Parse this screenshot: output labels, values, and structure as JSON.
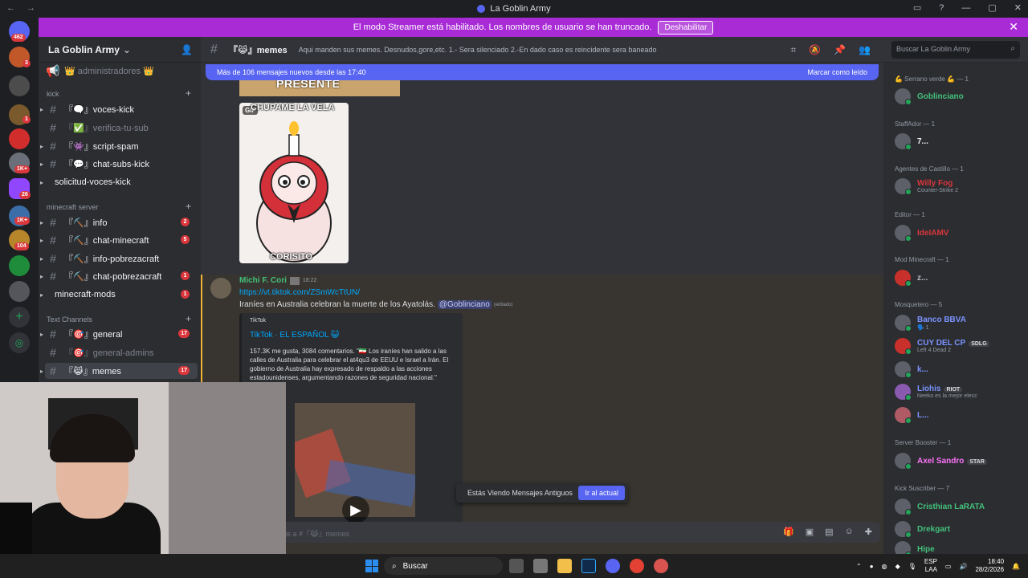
{
  "titlebar": {
    "title": "La Goblin Army"
  },
  "banner": {
    "text": "El modo Streamer está habilitado. Los nombres de usuario se han truncado.",
    "button": "Deshabilitar"
  },
  "guild": {
    "name": "La Goblin Army"
  },
  "channels": {
    "top_item": "👑 administradores 👑",
    "categories": {
      "kick": "kick",
      "minecraft": "minecraft server",
      "text": "Text Channels"
    },
    "kick_items": [
      {
        "label": "『🗨️』voces-kick",
        "count": ""
      },
      {
        "label": "『✅』verifica-tu-sub",
        "count": ""
      },
      {
        "label": "『👾』script-spam",
        "count": ""
      },
      {
        "label": "『💬』chat-subs-kick",
        "count": ""
      },
      {
        "label": "solicitud-voces-kick",
        "count": ""
      }
    ],
    "minecraft_items": [
      {
        "label": "『⛏️』info",
        "count": "2"
      },
      {
        "label": "『⛏️』chat-minecraft",
        "count": "5"
      },
      {
        "label": "『⛏️』info-pobrezacraft",
        "count": ""
      },
      {
        "label": "『⛏️』chat-pobrezacraft",
        "count": "1"
      },
      {
        "label": "minecraft-mods",
        "count": "1"
      }
    ],
    "text_items": [
      {
        "label": "『🎯』general",
        "count": "17"
      },
      {
        "label": "『🎯』general-admins",
        "count": ""
      },
      {
        "label": "『😹』memes",
        "count": "17"
      }
    ]
  },
  "header": {
    "channel": "『😹』memes",
    "topic": "Aqui manden sus memes. Desnudos,gore,etc. 1.- Sera silenciado 2.-En dado caso es reincidente sera baneado",
    "search_placeholder": "Buscar La Goblin Army"
  },
  "newbar": {
    "text": "Más de 106 mensajes nuevos desde las 17:40",
    "action": "Marcar como leído"
  },
  "images": {
    "top_caption": "PRESENTE",
    "gif_tag": "GIF",
    "gif_top": "CHUPAME LA VELA",
    "gif_bottom": "CORISITO"
  },
  "message": {
    "author": "Michi F. Cori",
    "time": "18:22",
    "link": "https://vt.tiktok.com/ZSmWcTtUN/",
    "text": "Iraníes en Australia celebran la muerte de los Ayatolás.",
    "mention": "@Goblinciano",
    "edited": "(editado)",
    "embed": {
      "provider": "TikTok",
      "title": "TikTok · EL ESPAÑOL 😺",
      "description": "157.3K me gusta, 3084 comentarios. \"🇮🇷 Los iraníes han salido a las calles de Australia para celebrar el at4qu3 de EEUU e Israel a Irán. El gobierno de Australia hay expresado de respaldo a las acciones estadounidenses, argumentando razones de seguridad nacional.\""
    }
  },
  "oldbar": {
    "text": "Estás Viendo Mensajes Antiguos",
    "button": "Ir al actual"
  },
  "composer": {
    "placeholder": "aje a #『😹』memes"
  },
  "members": {
    "roles": [
      {
        "label": "💪 Serrano verde 💪 — 1"
      },
      {
        "label": "StaffAdor — 1"
      },
      {
        "label": "Agentes de Castillo — 1"
      },
      {
        "label": "Editor — 1"
      },
      {
        "label": "Mod Minecraft — 1"
      },
      {
        "label": "Mosquetero — 5"
      },
      {
        "label": "Server Booster — 1"
      },
      {
        "label": "Kick Suscriber — 7"
      }
    ],
    "items": [
      {
        "name": "Goblinciano",
        "color": "#43c07a",
        "sub": "",
        "tag": ""
      },
      {
        "name": "7...",
        "color": "#f2f3f5",
        "sub": "",
        "tag": ""
      },
      {
        "name": "Willy Fog",
        "color": "#da373c",
        "sub": "Counter-Strike 2",
        "tag": ""
      },
      {
        "name": "IdeIAMV",
        "color": "#da373c",
        "sub": "",
        "tag": ""
      },
      {
        "name": "z...",
        "color": "#b5bac1",
        "sub": "",
        "tag": ""
      },
      {
        "name": "Banco BBVA",
        "color": "#7c93ff",
        "sub": "🗣️ 1",
        "tag": ""
      },
      {
        "name": "CUY DEL CP",
        "color": "#7c93ff",
        "sub": "Left 4 Dead 2",
        "tag": "SDLG"
      },
      {
        "name": "k...",
        "color": "#7c93ff",
        "sub": "",
        "tag": ""
      },
      {
        "name": "Liohis",
        "color": "#7c93ff",
        "sub": "Neeko es la mejor elecc",
        "tag": "RIOT"
      },
      {
        "name": "L...",
        "color": "#7c93ff",
        "sub": "",
        "tag": ""
      },
      {
        "name": "Axel Sandro",
        "color": "#ff73fa",
        "sub": "",
        "tag": "STAR"
      },
      {
        "name": "Cristhian LaRATA",
        "color": "#43c07a",
        "sub": "",
        "tag": ""
      },
      {
        "name": "Drekgart",
        "color": "#43c07a",
        "sub": "",
        "tag": ""
      },
      {
        "name": "Hipe",
        "color": "#43c07a",
        "sub": "",
        "tag": ""
      }
    ]
  },
  "taskbar": {
    "search": "Buscar",
    "lang": "ESP",
    "lang2": "LAA",
    "time": "18:40",
    "date": "28/2/2026"
  },
  "rail_badges": [
    "462",
    "3",
    "1",
    "1K+",
    "26",
    "1K+",
    "104"
  ]
}
